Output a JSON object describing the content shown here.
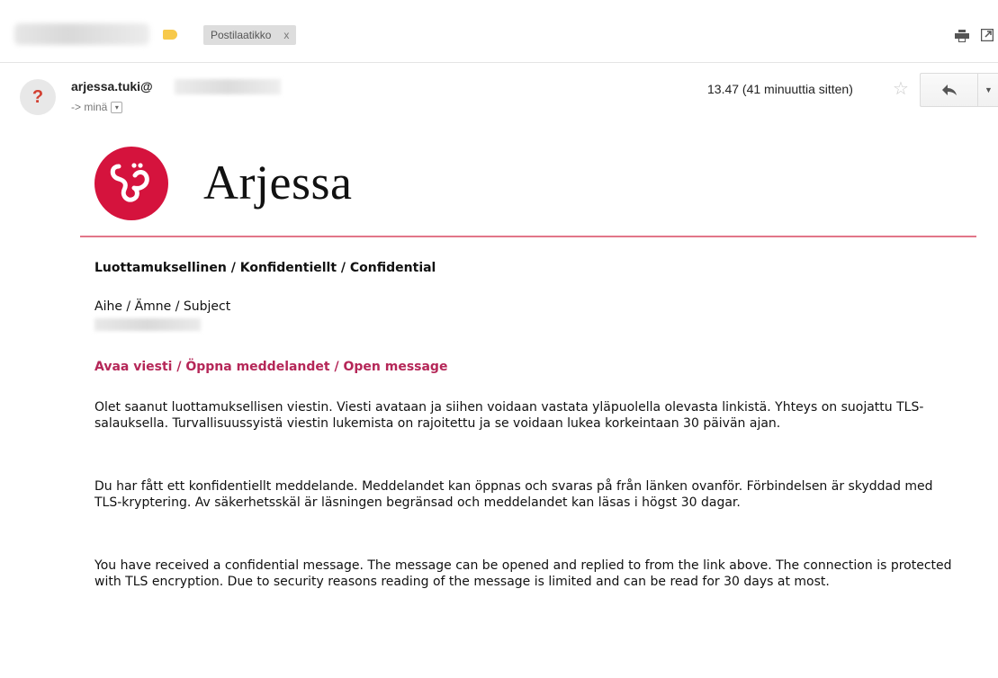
{
  "toolbar": {
    "chip_label": "Postilaatikko",
    "chip_close": "x",
    "label_color": "#f7c94b",
    "print_icon": "print-icon",
    "popout_icon": "popout-icon"
  },
  "message": {
    "avatar_glyph": "?",
    "sender": "arjessa.tuki@",
    "recipient": "-> minä",
    "recipient_dropdown": "▾",
    "timestamp": "13.47 (41 minuuttia sitten)",
    "star": "☆",
    "reply_icon": "🡄",
    "more_icon": "▼"
  },
  "logo": {
    "text": "Arjessa",
    "brand_color": "#d5133d"
  },
  "body": {
    "confidential": "Luottamuksellinen / Konfidentiellt / Confidential",
    "subject_label": "Aihe / Ämne / Subject",
    "open_link": "Avaa viesti / Öppna meddelandet / Open message",
    "link_color": "#b52758",
    "paragraph_fi": "Olet saanut luottamuksellisen viestin. Viesti avataan ja siihen voidaan vastata yläpuolella olevasta linkistä. Yhteys on suojattu TLS-salauksella. Turvallisuussyistä viestin lukemista on rajoitettu ja se voidaan lukea korkeintaan 30 päivän ajan.",
    "paragraph_sv": "Du har fått ett konfidentiellt meddelande. Meddelandet kan öppnas och svaras på från länken ovanför. Förbindelsen är skyddad med TLS-kryptering. Av säkerhetsskäl är läsningen begränsad och meddelandet kan läsas i högst 30 dagar.",
    "paragraph_en": "You have received a confidential message. The message can be opened and replied to from the link above. The connection is protected with TLS encryption. Due to security reasons reading of the message is limited and can be read for 30 days at most."
  }
}
